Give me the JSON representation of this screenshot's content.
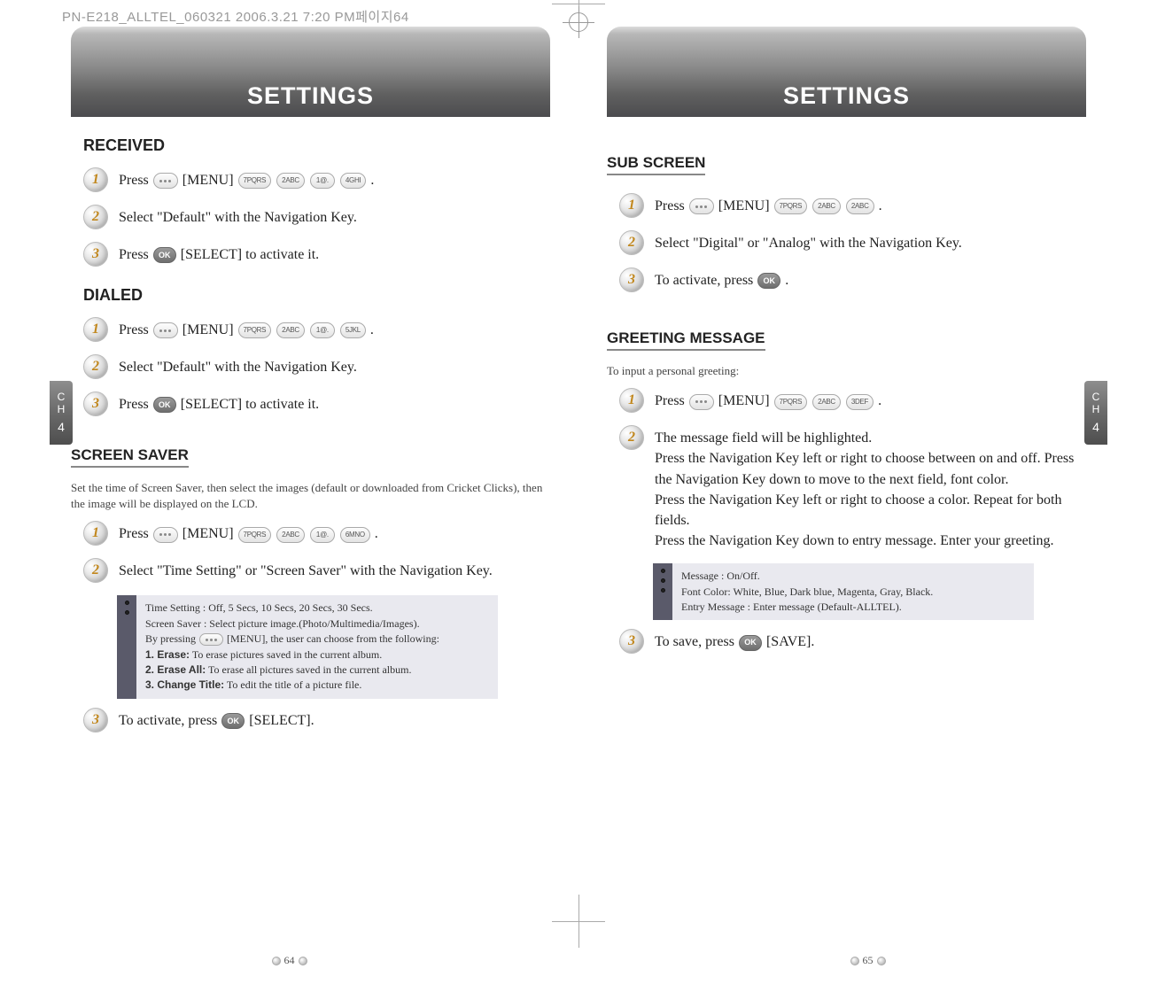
{
  "doc_header": "PN-E218_ALLTEL_060321  2006.3.21 7:20 PM페이지64",
  "left": {
    "tab_title": "SETTINGS",
    "side_tab": {
      "line1": "C",
      "line2": "H",
      "line3": "4"
    },
    "sections": {
      "received": {
        "title": "RECEIVED",
        "step1_prefix": "Press ",
        "step1_menu": "[MENU]",
        "step1_keys": [
          "7PQRS",
          "2ABC",
          "1@.",
          "4GHI"
        ],
        "step1_suffix": ".",
        "step2": "Select \"Default\" with the Navigation Key.",
        "step3_prefix": "Press ",
        "step3_ok": "OK",
        "step3_suffix": " [SELECT] to activate it."
      },
      "dialed": {
        "title": "DIALED",
        "step1_prefix": "Press ",
        "step1_menu": "[MENU]",
        "step1_keys": [
          "7PQRS",
          "2ABC",
          "1@.",
          "5JKL"
        ],
        "step1_suffix": ".",
        "step2": "Select \"Default\" with the Navigation Key.",
        "step3_prefix": "Press ",
        "step3_ok": "OK",
        "step3_suffix": " [SELECT] to activate it."
      },
      "screen_saver": {
        "title": "SCREEN SAVER",
        "intro": "Set the time of Screen Saver, then select the images (default or downloaded from Cricket Clicks), then the image will be displayed on the LCD.",
        "step1_prefix": "Press ",
        "step1_menu": "[MENU]",
        "step1_keys": [
          "7PQRS",
          "2ABC",
          "1@.",
          "6MNO"
        ],
        "step1_suffix": ".",
        "step2": "Select \"Time Setting\" or \"Screen Saver\" with the Navigation Key.",
        "info": {
          "time_setting": "Time Setting : Off, 5 Secs, 10 Secs, 20 Secs, 30 Secs.",
          "screen_saver_line": "Screen Saver : Select picture image.(Photo/Multimedia/Images).",
          "by_pressing_prefix": "By pressing",
          "by_pressing_suffix": "[MENU], the user can choose from the following:",
          "item1_label": "1.  Erase:",
          "item1_text": " To erase pictures saved in the current album.",
          "item2_label": "2.  Erase All:",
          "item2_text": " To erase all pictures saved in the current album.",
          "item3_label": "3.  Change Title:",
          "item3_text": " To edit the title of a picture file."
        },
        "step3_prefix": "To activate, press ",
        "step3_ok": "OK",
        "step3_suffix": " [SELECT]."
      }
    },
    "page_num": "64"
  },
  "right": {
    "tab_title": "SETTINGS",
    "side_tab": {
      "line1": "C",
      "line2": "H",
      "line3": "4"
    },
    "sections": {
      "sub_screen": {
        "title": "SUB SCREEN",
        "step1_prefix": "Press ",
        "step1_menu": "[MENU]",
        "step1_keys": [
          "7PQRS",
          "2ABC",
          "2ABC"
        ],
        "step1_suffix": ".",
        "step2": "Select \"Digital\" or \"Analog\" with the Navigation Key.",
        "step3_prefix": "To activate, press ",
        "step3_ok": "OK",
        "step3_suffix": " ."
      },
      "greeting": {
        "title": "GREETING MESSAGE",
        "intro": "To input a personal greeting:",
        "step1_prefix": "Press ",
        "step1_menu": "[MENU]",
        "step1_keys": [
          "7PQRS",
          "2ABC",
          "3DEF"
        ],
        "step1_suffix": ".",
        "step2": "The message field will be highlighted.\nPress the Navigation Key left or right to choose between on and off. Press the Navigation Key down to move to the next field, font color.\nPress the Navigation Key left or right to choose a color. Repeat for both fields.\nPress the Navigation Key down to entry message. Enter your greeting.",
        "info": {
          "l1": "Message : On/Off.",
          "l2": "Font Color: White, Blue, Dark blue, Magenta, Gray, Black.",
          "l3": "Entry Message : Enter message (Default-ALLTEL)."
        },
        "step3_prefix": "To save, press ",
        "step3_ok": "OK",
        "step3_suffix": "  [SAVE]."
      }
    },
    "page_num": "65"
  },
  "chart_data": null
}
